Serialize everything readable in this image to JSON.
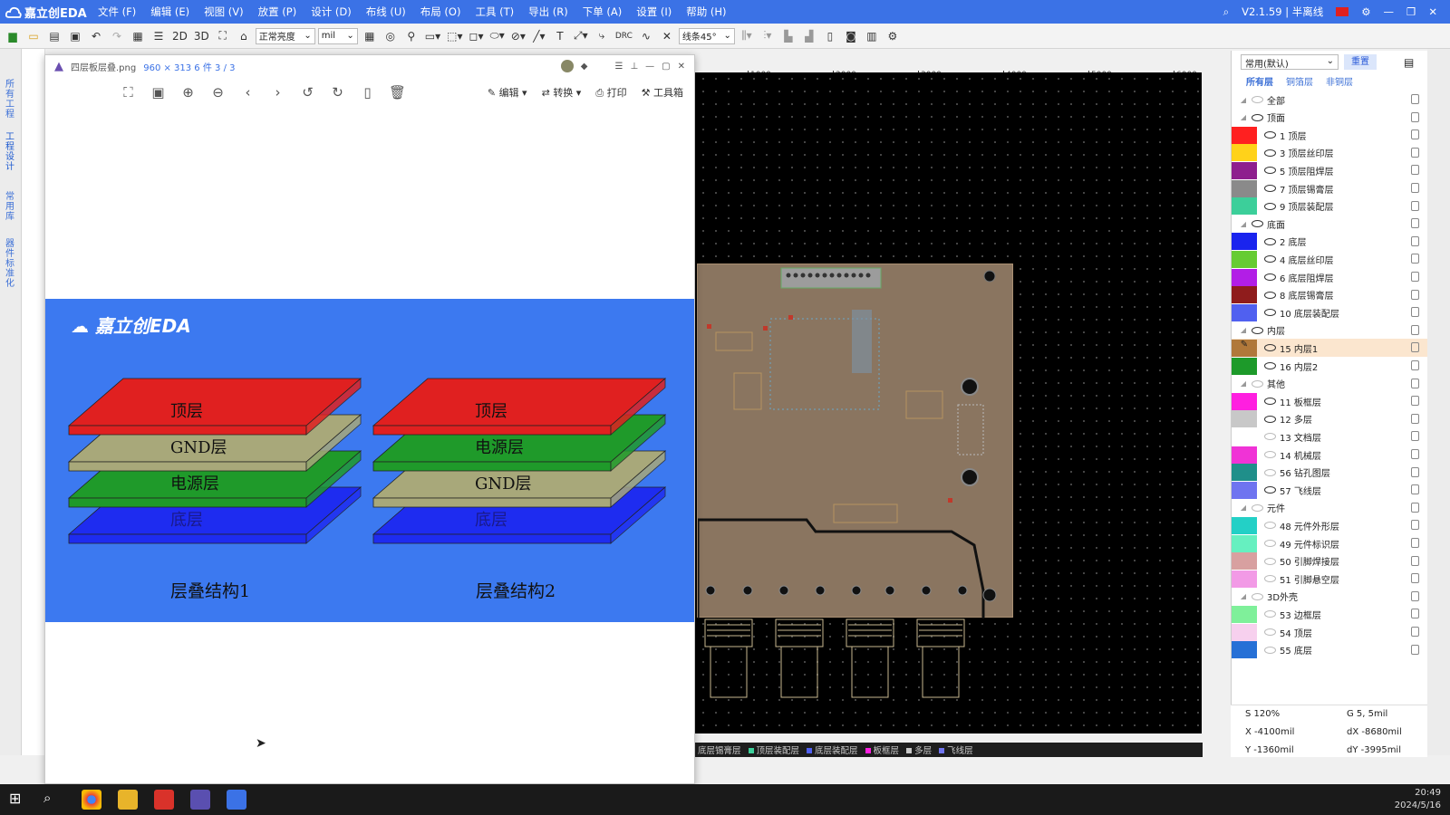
{
  "app": {
    "title": "嘉立创EDA",
    "version": "V2.1.59 | 半离线"
  },
  "menu": [
    "文件 (F)",
    "编辑 (E)",
    "视图 (V)",
    "放置 (P)",
    "设计 (D)",
    "布线 (U)",
    "布局 (O)",
    "工具 (T)",
    "导出 (R)",
    "下单 (A)",
    "设置 (I)",
    "帮助 (H)"
  ],
  "toolbar": {
    "view2d": "2D",
    "view3d": "3D",
    "brightness": "正常亮度",
    "unit": "mil",
    "route_mode": "线条45°",
    "drc": "DRC"
  },
  "left_rail": {
    "tab1": "所有工程",
    "tab2": "工程设计",
    "tab3": "常用库",
    "tab4": "器件标准化"
  },
  "viewer": {
    "filename": "四层板层叠.png",
    "info": "960 × 313 6 件 3 / 3",
    "edit": "编辑",
    "convert": "转换",
    "print": "打印",
    "toolbox": "工具箱",
    "brand": "嘉立创EDA",
    "stack1": {
      "layers": [
        "顶层",
        "GND层",
        "电源层",
        "底层"
      ],
      "caption": "层叠结构1"
    },
    "stack2": {
      "layers": [
        "顶层",
        "电源层",
        "GND层",
        "底层"
      ],
      "caption": "层叠结构2"
    },
    "colors": {
      "top": "#e02020",
      "gnd": "#a8a87a",
      "power": "#1f9a2a",
      "bottom": "#1e2cf0",
      "bg": "#3c79f0"
    }
  },
  "ruler": [
    "1000",
    "2000",
    "3000",
    "4000",
    "5000",
    "6000"
  ],
  "statusbar": [
    "底层锡膏层",
    "顶层装配层",
    "底层装配层",
    "板框层",
    "多层",
    "飞线层"
  ],
  "layers": {
    "preset": "常用(默认)",
    "reset": "重置",
    "tabs": [
      "所有层",
      "铜箔层",
      "非铜层"
    ],
    "rows": [
      {
        "group": true,
        "label": "全部",
        "color": null,
        "visible": false
      },
      {
        "group": true,
        "label": "顶面",
        "color": null,
        "visible": true
      },
      {
        "label": "1 顶层",
        "color": "#ff2020",
        "visible": true
      },
      {
        "label": "3 顶层丝印层",
        "color": "#ffd21a",
        "visible": true
      },
      {
        "label": "5 顶层阻焊层",
        "color": "#8e1f8e",
        "visible": true
      },
      {
        "label": "7 顶层锡膏层",
        "color": "#8a8a8a",
        "visible": true
      },
      {
        "label": "9 顶层装配层",
        "color": "#3ccf9a",
        "visible": true
      },
      {
        "group": true,
        "label": "底面",
        "color": null,
        "visible": true
      },
      {
        "label": "2 底层",
        "color": "#1a24ee",
        "visible": true
      },
      {
        "label": "4 底层丝印层",
        "color": "#66cc33",
        "visible": true
      },
      {
        "label": "6 底层阻焊层",
        "color": "#b21ee6",
        "visible": true
      },
      {
        "label": "8 底层锡膏层",
        "color": "#8f1c1c",
        "visible": true
      },
      {
        "label": "10 底层装配层",
        "color": "#5060f0",
        "visible": true
      },
      {
        "group": true,
        "label": "内层",
        "color": null,
        "visible": true
      },
      {
        "label": "15 内层1",
        "color": "#b0783a",
        "visible": true,
        "active": true
      },
      {
        "label": "16 内层2",
        "color": "#1d9a2a",
        "visible": true
      },
      {
        "group": true,
        "label": "其他",
        "color": null,
        "visible": false
      },
      {
        "label": "11 板框层",
        "color": "#ff1fe0",
        "visible": true
      },
      {
        "label": "12 多层",
        "color": "#c8c8c8",
        "visible": true
      },
      {
        "label": "13 文档层",
        "color": "#ffffff",
        "visible": false
      },
      {
        "label": "14 机械层",
        "color": "#f033d6",
        "visible": false
      },
      {
        "label": "56 钻孔图层",
        "color": "#1f8f8a",
        "visible": false
      },
      {
        "label": "57 飞线层",
        "color": "#6f74f0",
        "visible": true
      },
      {
        "group": true,
        "label": "元件",
        "color": null,
        "visible": false
      },
      {
        "label": "48 元件外形层",
        "color": "#23d0c6",
        "visible": false
      },
      {
        "label": "49 元件标识层",
        "color": "#66f0c0",
        "visible": false
      },
      {
        "label": "50 引脚焊接层",
        "color": "#d8a0a0",
        "visible": false
      },
      {
        "label": "51 引脚悬空层",
        "color": "#f29ae6",
        "visible": false
      },
      {
        "group": true,
        "label": "3D外壳",
        "color": null,
        "visible": false
      },
      {
        "label": "53 边框层",
        "color": "#7ff09a",
        "visible": false
      },
      {
        "label": "54 顶层",
        "color": "#f7d0ee",
        "visible": false
      },
      {
        "label": "55 底层",
        "color": "#2670d6",
        "visible": false
      }
    ]
  },
  "coords": {
    "s": "S  120%",
    "g": "G  5, 5mil",
    "x": "X  -4100mil",
    "dx": "dX  -8680mil",
    "y": "Y  -1360mil",
    "dy": "dY  -3995mil"
  },
  "taskbar": {
    "time": "20:49",
    "date": "2024/5/16"
  }
}
